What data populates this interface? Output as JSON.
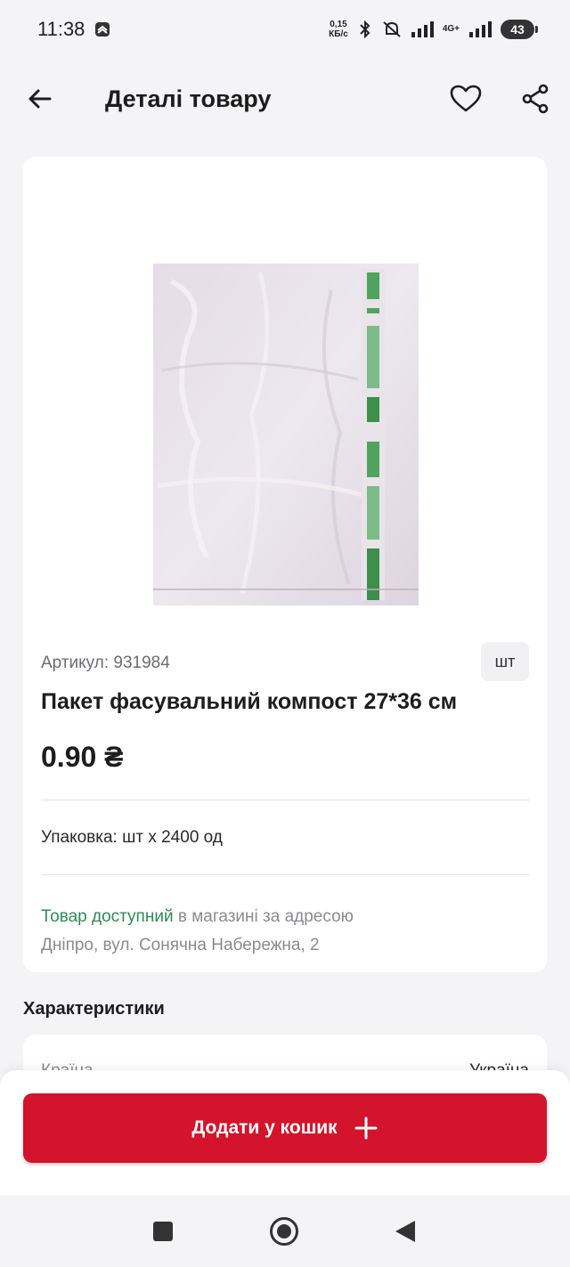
{
  "status_bar": {
    "time": "11:38",
    "speed_value": "0,15",
    "speed_unit": "КБ/с",
    "network": "4G+",
    "battery": "43"
  },
  "header": {
    "title": "Деталі товару",
    "back_icon": "arrow-left-icon",
    "favorite_icon": "heart-icon",
    "share_icon": "share-icon"
  },
  "product": {
    "sku": "Артикул: 931984",
    "unit": "шт",
    "name": "Пакет фасувальний компост 27*36 см",
    "price": "0.90 ₴",
    "packaging": "Упаковка: шт x 2400 од",
    "availability_highlight": "Товар доступний",
    "availability_rest": " в магазині за адресою",
    "address": "Дніпро, вул. Сонячна Набережна, 2"
  },
  "characteristics": {
    "title": "Характеристики",
    "rows": [
      {
        "label": "Країна",
        "value": "Україна"
      }
    ]
  },
  "cart": {
    "add_label": "Додати у кошик"
  },
  "colors": {
    "accent": "#d3142c",
    "available": "#2e8b57"
  }
}
